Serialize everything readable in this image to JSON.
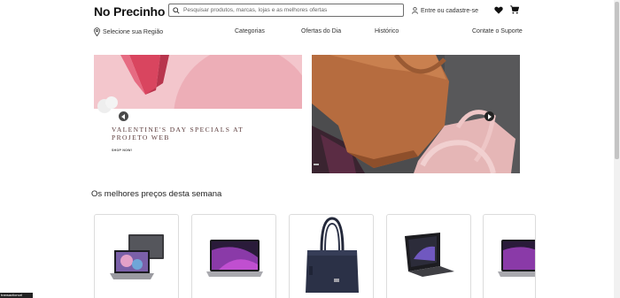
{
  "header": {
    "logo": "No Precinho",
    "search_placeholder": "Pesquisar produtos, marcas, lojas e as melhores ofertas",
    "login_label": "Entre ou cadastre-se"
  },
  "nav": {
    "region_label": "Selecione sua Região",
    "links": [
      "Categorias",
      "Ofertas do Dia",
      "Histórico",
      "Contate o Suporte"
    ]
  },
  "hero": {
    "title_line1": "VALENTINE'S DAY SPECIALS AT",
    "title_line2": "PROJETO WEB",
    "shop_label": "SHOP NOW!"
  },
  "section": {
    "title": "Os melhores preços desta semana"
  },
  "products": [
    {
      "name": "laptop-with-monitor"
    },
    {
      "name": "macbook-pro"
    },
    {
      "name": "navy-tote-bag"
    },
    {
      "name": "folded-laptop"
    },
    {
      "name": "macbook-pro-partial"
    }
  ],
  "status": {
    "bottom_tooltip": "transactionurl"
  },
  "colors": {
    "hero_pink": "#f3c6cc",
    "accent": "#111111"
  }
}
